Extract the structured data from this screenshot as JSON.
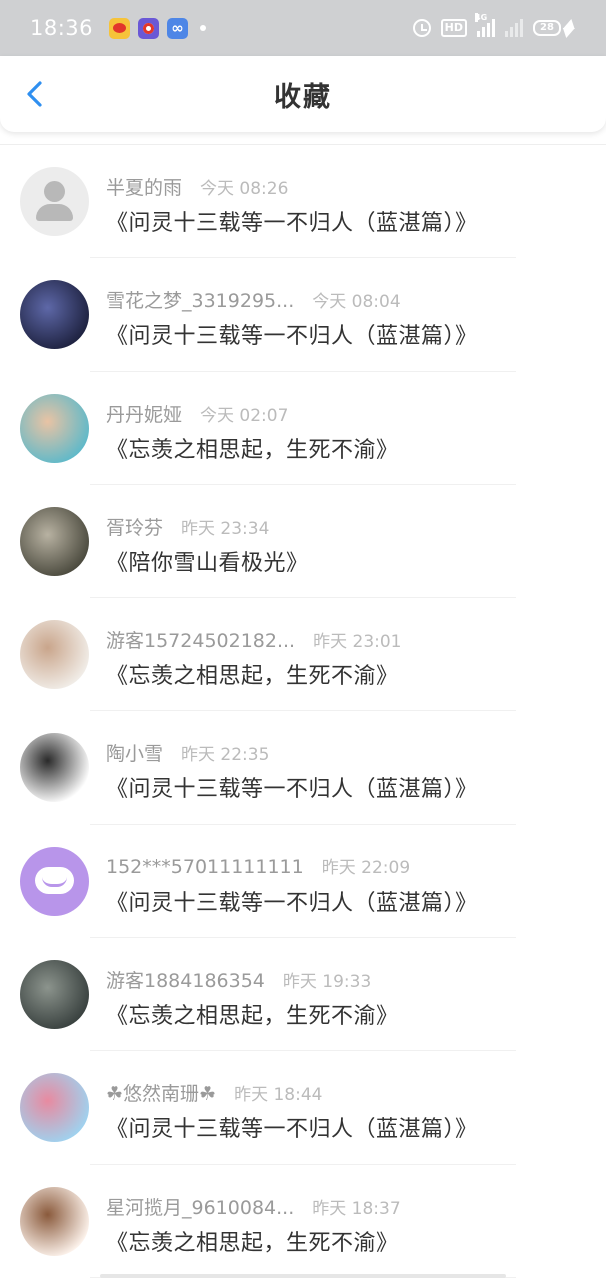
{
  "status_bar": {
    "time": "18:36",
    "apps": [
      "weibo-icon",
      "music-icon",
      "loop-icon"
    ],
    "hd_label": "HD",
    "network_label": "4G",
    "battery_level": "28"
  },
  "header": {
    "title": "收藏",
    "back_icon": "chevron-left-icon",
    "accent_color": "#2f8ff0"
  },
  "items": [
    {
      "username": "半夏的雨",
      "time": "今天 08:26",
      "title": "《问灵十三载等一不归人（蓝湛篇）》",
      "avatar": "default-avatar",
      "avatar_colors": [
        "#ececec",
        "#ececec"
      ]
    },
    {
      "username": "雪花之梦_3319295...",
      "time": "今天 08:04",
      "title": "《问灵十三载等一不归人（蓝湛篇）》",
      "avatar": "photo-avatar",
      "avatar_colors": [
        "#1e2240",
        "#5e68a8"
      ]
    },
    {
      "username": "丹丹妮娅",
      "time": "今天 02:07",
      "title": "《忘羡之相思起，生死不渝》",
      "avatar": "photo-avatar",
      "avatar_colors": [
        "#5fb9c9",
        "#e9c3a4"
      ]
    },
    {
      "username": "胥玲芬",
      "time": "昨天 23:34",
      "title": "《陪你雪山看极光》",
      "avatar": "photo-avatar",
      "avatar_colors": [
        "#4b4a3e",
        "#b8b2a2"
      ]
    },
    {
      "username": "游客15724502182...",
      "time": "昨天 23:01",
      "title": "《忘羡之相思起，生死不渝》",
      "avatar": "photo-avatar",
      "avatar_colors": [
        "#f1ede8",
        "#c9a58b"
      ]
    },
    {
      "username": "陶小雪",
      "time": "昨天 22:35",
      "title": "《问灵十三载等一不归人（蓝湛篇）》",
      "avatar": "photo-avatar",
      "avatar_colors": [
        "#ffffff",
        "#2a2a2a"
      ]
    },
    {
      "username": "152***57011111111",
      "time": "昨天 22:09",
      "title": "《问灵十三载等一不归人（蓝湛篇）》",
      "avatar": "chat-avatar",
      "avatar_colors": [
        "#b895ea",
        "#b895ea"
      ]
    },
    {
      "username": "游客1884186354",
      "time": "昨天 19:33",
      "title": "《忘羡之相思起，生死不渝》",
      "avatar": "photo-avatar",
      "avatar_colors": [
        "#39413f",
        "#8c948d"
      ]
    },
    {
      "username": "☘悠然南珊☘",
      "time": "昨天 18:44",
      "title": "《问灵十三载等一不归人（蓝湛篇）》",
      "avatar": "photo-avatar",
      "avatar_colors": [
        "#9fd2ef",
        "#e88aa0"
      ]
    },
    {
      "username": "星河揽月_9610084...",
      "time": "昨天 18:37",
      "title": "《忘羡之相思起，生死不渝》",
      "avatar": "photo-avatar",
      "avatar_colors": [
        "#fdf3ec",
        "#8a5a3c"
      ]
    }
  ]
}
